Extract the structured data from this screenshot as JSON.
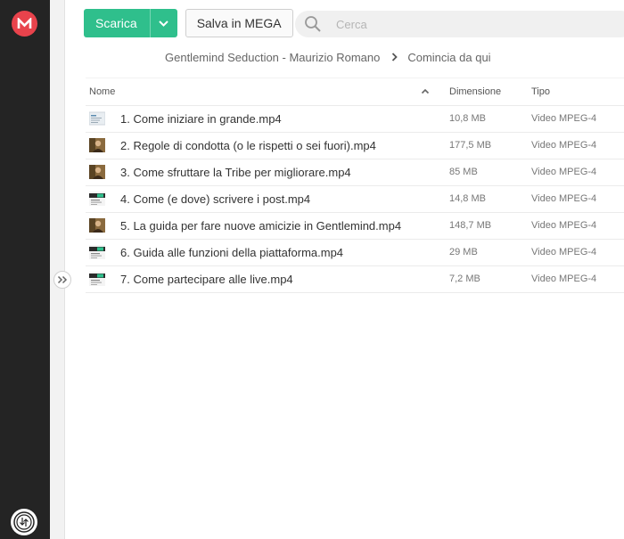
{
  "toolbar": {
    "download_label": "Scarica",
    "save_label": "Salva in MEGA"
  },
  "search": {
    "placeholder": "Cerca"
  },
  "breadcrumb": {
    "parent": "Gentlemind Seduction - Maurizio Romano",
    "current": "Comincia da qui"
  },
  "table": {
    "columns": {
      "name": "Nome",
      "size": "Dimensione",
      "type": "Tipo"
    },
    "rows": [
      {
        "name": "1. Come iniziare in grande.mp4",
        "size": "10,8 MB",
        "type": "Video MPEG-4",
        "thumb": "screen"
      },
      {
        "name": "2. Regole di condotta (o le rispetti o sei fuori).mp4",
        "size": "177,5 MB",
        "type": "Video MPEG-4",
        "thumb": "person"
      },
      {
        "name": "3. Come sfruttare la Tribe per migliorare.mp4",
        "size": "85 MB",
        "type": "Video MPEG-4",
        "thumb": "person"
      },
      {
        "name": "4. Come (e dove) scrivere i post.mp4",
        "size": "14,8 MB",
        "type": "Video MPEG-4",
        "thumb": "screen-dark"
      },
      {
        "name": "5. La guida per fare nuove amicizie in Gentlemind.mp4",
        "size": "148,7 MB",
        "type": "Video MPEG-4",
        "thumb": "person"
      },
      {
        "name": "6. Guida alle funzioni della piattaforma.mp4",
        "size": "29 MB",
        "type": "Video MPEG-4",
        "thumb": "screen-dark"
      },
      {
        "name": "7. Come partecipare alle live.mp4",
        "size": "7,2 MB",
        "type": "Video MPEG-4",
        "thumb": "screen-dark"
      }
    ]
  },
  "colors": {
    "accent": "#2fbf8c",
    "mega_red": "#e8434c",
    "sidebar": "#242424"
  },
  "icons": [
    "mega-logo-icon",
    "transfer-manager-icon",
    "expand-chevrons-icon",
    "chevron-down-icon",
    "search-icon",
    "chevron-right-icon",
    "sort-up-icon"
  ]
}
